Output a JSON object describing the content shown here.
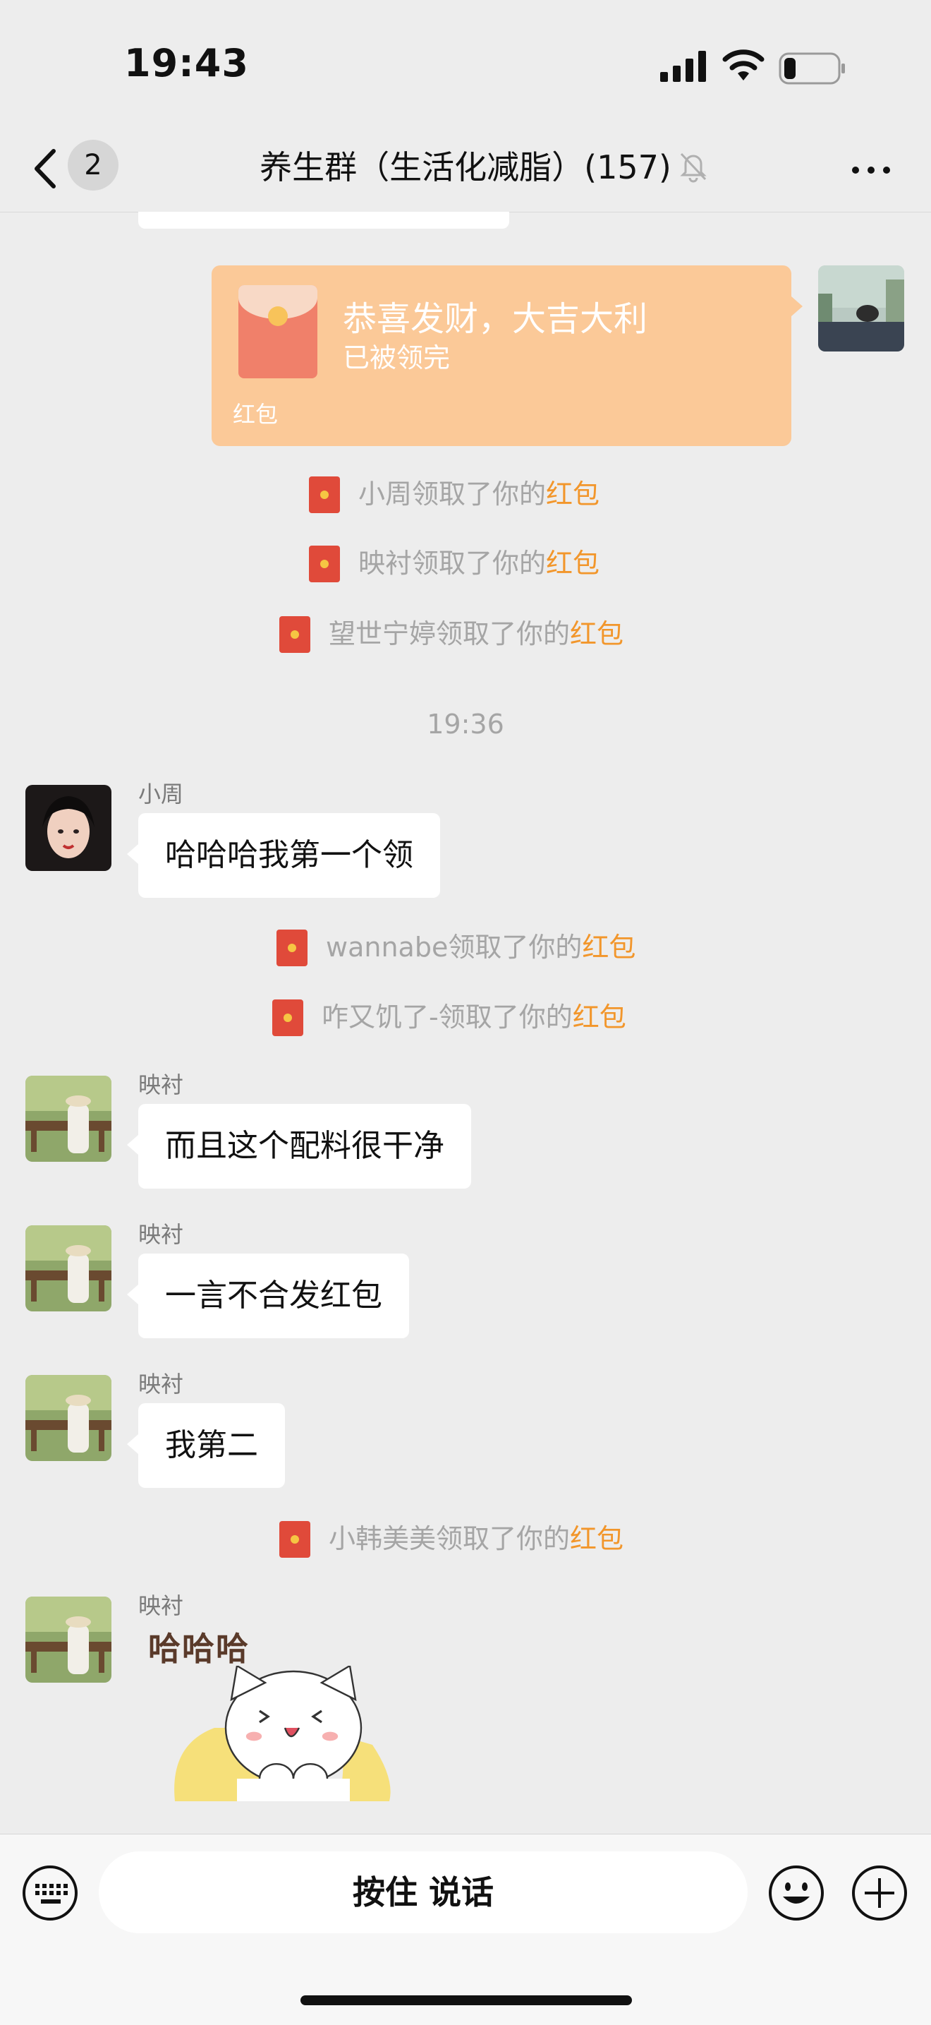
{
  "status_bar": {
    "time": "19:43"
  },
  "nav": {
    "back_label": "",
    "unread_count": "2",
    "title": "养生群（生活化减脂）(157)"
  },
  "red_packet": {
    "greeting": "恭喜发财，大吉大利",
    "status": "已被领完",
    "footer": "红包"
  },
  "notices": [
    {
      "prefix": "小周领取了你的",
      "link": "红包"
    },
    {
      "prefix": "映衬领取了你的",
      "link": "红包"
    },
    {
      "prefix": "望世宁婷领取了你的",
      "link": "红包"
    },
    {
      "prefix": "wannabe领取了你的",
      "link": "红包"
    },
    {
      "prefix": "咋又饥了-领取了你的",
      "link": "红包"
    },
    {
      "prefix": "小韩美美领取了你的",
      "link": "红包"
    }
  ],
  "timestamp": "19:36",
  "messages": [
    {
      "sender": "小周",
      "text": "哈哈哈我第一个领"
    },
    {
      "sender": "映衬",
      "text": "而且这个配料很干净"
    },
    {
      "sender": "映衬",
      "text": "一言不合发红包"
    },
    {
      "sender": "映衬",
      "text": "我第二"
    },
    {
      "sender": "映衬",
      "sticker_text": "哈哈哈"
    }
  ],
  "input_bar": {
    "hold_to_talk": "按住 说话"
  },
  "icons": {
    "back": "chevron-left-icon",
    "mute": "bell-slash-icon",
    "more": "more-horizontal-icon",
    "keyboard": "keyboard-icon",
    "emoji": "smiley-icon",
    "plus": "plus-icon",
    "red_packet": "red-packet-icon"
  },
  "colors": {
    "background": "#ededed",
    "red_packet_bubble": "#fbc998",
    "highlight": "#f2962b",
    "notice_text": "#a5a5a5"
  }
}
